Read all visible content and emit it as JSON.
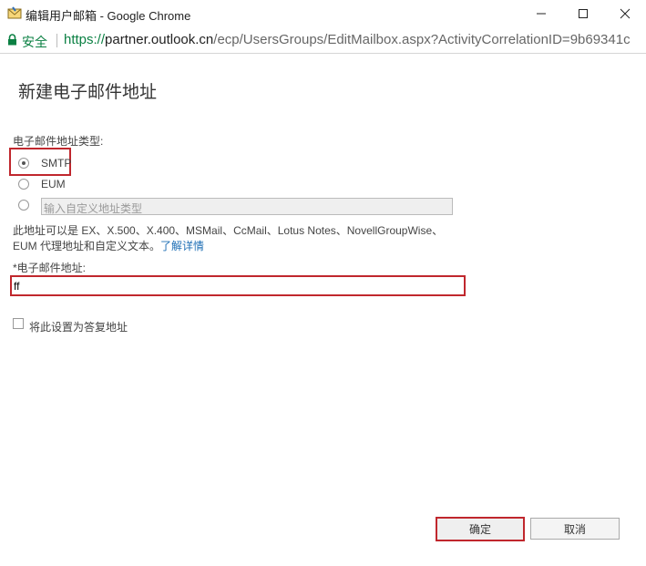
{
  "window": {
    "title": "编辑用户邮箱 - Google Chrome",
    "icons": [
      "mail-icon",
      "minimize-icon",
      "maximize-icon",
      "close-icon"
    ]
  },
  "addressbar": {
    "secure_label": "安全",
    "url_protocol": "https://",
    "url_host": "partner.outlook.cn",
    "url_path": "/ecp/UsersGroups/EditMailbox.aspx?ActivityCorrelationID=9b69341c"
  },
  "dialog": {
    "title": "新建电子邮件地址",
    "type_label": "电子邮件地址类型:",
    "options": [
      {
        "label": "SMTP",
        "checked": true
      },
      {
        "label": "EUM",
        "checked": false
      },
      {
        "label": "",
        "checked": false
      }
    ],
    "custom_type_placeholder": "输入自定义地址类型",
    "description": "此地址可以是 EX、X.500、X.400、MSMail、CcMail、Lotus Notes、NovellGroupWise、EUM 代理地址和自定义文本。",
    "learn_more": "了解详情",
    "email_label": "*电子邮件地址:",
    "email_value": "ff",
    "reply_checkbox_label": "将此设置为答复地址",
    "reply_checked": false,
    "ok_label": "确定",
    "cancel_label": "取消"
  },
  "colors": {
    "highlight": "#c0272d",
    "secure_green": "#0b8043",
    "link_blue": "#1f6fb5"
  }
}
